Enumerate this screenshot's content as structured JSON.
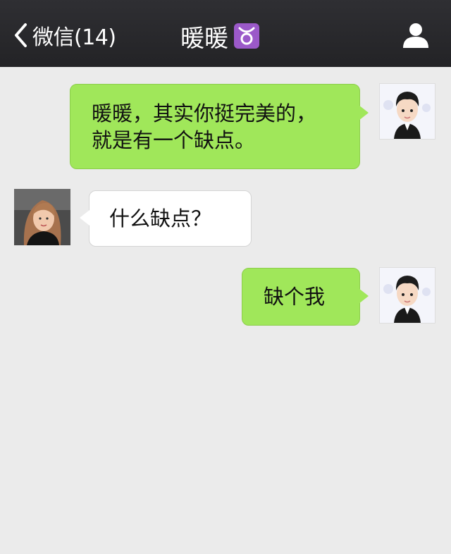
{
  "header": {
    "back_label": "微信(14)",
    "title": "暖暖",
    "title_emoji": "♉"
  },
  "messages": [
    {
      "sender": "me",
      "text": "暖暖，其实你挺完美的，\n就是有一个缺点。"
    },
    {
      "sender": "them",
      "text": "什么缺点？"
    },
    {
      "sender": "me",
      "text": "缺个我"
    }
  ],
  "colors": {
    "header_bg": "#2a2a2d",
    "background": "#ebebeb",
    "my_bubble": "#a0e75a",
    "their_bubble": "#ffffff"
  }
}
